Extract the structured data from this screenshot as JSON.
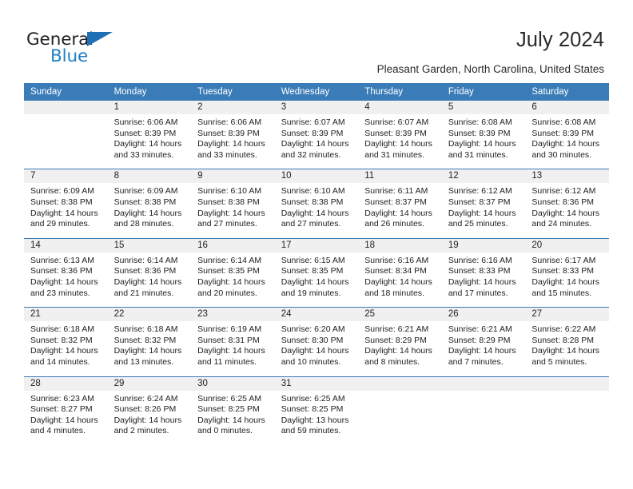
{
  "brand": {
    "name_part1": "General",
    "name_part2": "Blue",
    "logo_icon": "blue-triangle-icon",
    "color_primary": "#1f7fc4",
    "color_text": "#231f20"
  },
  "header": {
    "title": "July 2024",
    "subtitle": "Pleasant Garden, North Carolina, United States"
  },
  "calendar": {
    "header_bg": "#3a7cb8",
    "daynum_bg": "#f0f0f0",
    "columns": [
      "Sunday",
      "Monday",
      "Tuesday",
      "Wednesday",
      "Thursday",
      "Friday",
      "Saturday"
    ],
    "weeks": [
      [
        {
          "day": "",
          "lines": []
        },
        {
          "day": "1",
          "lines": [
            "Sunrise: 6:06 AM",
            "Sunset: 8:39 PM",
            "Daylight: 14 hours",
            "and 33 minutes."
          ]
        },
        {
          "day": "2",
          "lines": [
            "Sunrise: 6:06 AM",
            "Sunset: 8:39 PM",
            "Daylight: 14 hours",
            "and 33 minutes."
          ]
        },
        {
          "day": "3",
          "lines": [
            "Sunrise: 6:07 AM",
            "Sunset: 8:39 PM",
            "Daylight: 14 hours",
            "and 32 minutes."
          ]
        },
        {
          "day": "4",
          "lines": [
            "Sunrise: 6:07 AM",
            "Sunset: 8:39 PM",
            "Daylight: 14 hours",
            "and 31 minutes."
          ]
        },
        {
          "day": "5",
          "lines": [
            "Sunrise: 6:08 AM",
            "Sunset: 8:39 PM",
            "Daylight: 14 hours",
            "and 31 minutes."
          ]
        },
        {
          "day": "6",
          "lines": [
            "Sunrise: 6:08 AM",
            "Sunset: 8:39 PM",
            "Daylight: 14 hours",
            "and 30 minutes."
          ]
        }
      ],
      [
        {
          "day": "7",
          "lines": [
            "Sunrise: 6:09 AM",
            "Sunset: 8:38 PM",
            "Daylight: 14 hours",
            "and 29 minutes."
          ]
        },
        {
          "day": "8",
          "lines": [
            "Sunrise: 6:09 AM",
            "Sunset: 8:38 PM",
            "Daylight: 14 hours",
            "and 28 minutes."
          ]
        },
        {
          "day": "9",
          "lines": [
            "Sunrise: 6:10 AM",
            "Sunset: 8:38 PM",
            "Daylight: 14 hours",
            "and 27 minutes."
          ]
        },
        {
          "day": "10",
          "lines": [
            "Sunrise: 6:10 AM",
            "Sunset: 8:38 PM",
            "Daylight: 14 hours",
            "and 27 minutes."
          ]
        },
        {
          "day": "11",
          "lines": [
            "Sunrise: 6:11 AM",
            "Sunset: 8:37 PM",
            "Daylight: 14 hours",
            "and 26 minutes."
          ]
        },
        {
          "day": "12",
          "lines": [
            "Sunrise: 6:12 AM",
            "Sunset: 8:37 PM",
            "Daylight: 14 hours",
            "and 25 minutes."
          ]
        },
        {
          "day": "13",
          "lines": [
            "Sunrise: 6:12 AM",
            "Sunset: 8:36 PM",
            "Daylight: 14 hours",
            "and 24 minutes."
          ]
        }
      ],
      [
        {
          "day": "14",
          "lines": [
            "Sunrise: 6:13 AM",
            "Sunset: 8:36 PM",
            "Daylight: 14 hours",
            "and 23 minutes."
          ]
        },
        {
          "day": "15",
          "lines": [
            "Sunrise: 6:14 AM",
            "Sunset: 8:36 PM",
            "Daylight: 14 hours",
            "and 21 minutes."
          ]
        },
        {
          "day": "16",
          "lines": [
            "Sunrise: 6:14 AM",
            "Sunset: 8:35 PM",
            "Daylight: 14 hours",
            "and 20 minutes."
          ]
        },
        {
          "day": "17",
          "lines": [
            "Sunrise: 6:15 AM",
            "Sunset: 8:35 PM",
            "Daylight: 14 hours",
            "and 19 minutes."
          ]
        },
        {
          "day": "18",
          "lines": [
            "Sunrise: 6:16 AM",
            "Sunset: 8:34 PM",
            "Daylight: 14 hours",
            "and 18 minutes."
          ]
        },
        {
          "day": "19",
          "lines": [
            "Sunrise: 6:16 AM",
            "Sunset: 8:33 PM",
            "Daylight: 14 hours",
            "and 17 minutes."
          ]
        },
        {
          "day": "20",
          "lines": [
            "Sunrise: 6:17 AM",
            "Sunset: 8:33 PM",
            "Daylight: 14 hours",
            "and 15 minutes."
          ]
        }
      ],
      [
        {
          "day": "21",
          "lines": [
            "Sunrise: 6:18 AM",
            "Sunset: 8:32 PM",
            "Daylight: 14 hours",
            "and 14 minutes."
          ]
        },
        {
          "day": "22",
          "lines": [
            "Sunrise: 6:18 AM",
            "Sunset: 8:32 PM",
            "Daylight: 14 hours",
            "and 13 minutes."
          ]
        },
        {
          "day": "23",
          "lines": [
            "Sunrise: 6:19 AM",
            "Sunset: 8:31 PM",
            "Daylight: 14 hours",
            "and 11 minutes."
          ]
        },
        {
          "day": "24",
          "lines": [
            "Sunrise: 6:20 AM",
            "Sunset: 8:30 PM",
            "Daylight: 14 hours",
            "and 10 minutes."
          ]
        },
        {
          "day": "25",
          "lines": [
            "Sunrise: 6:21 AM",
            "Sunset: 8:29 PM",
            "Daylight: 14 hours",
            "and 8 minutes."
          ]
        },
        {
          "day": "26",
          "lines": [
            "Sunrise: 6:21 AM",
            "Sunset: 8:29 PM",
            "Daylight: 14 hours",
            "and 7 minutes."
          ]
        },
        {
          "day": "27",
          "lines": [
            "Sunrise: 6:22 AM",
            "Sunset: 8:28 PM",
            "Daylight: 14 hours",
            "and 5 minutes."
          ]
        }
      ],
      [
        {
          "day": "28",
          "lines": [
            "Sunrise: 6:23 AM",
            "Sunset: 8:27 PM",
            "Daylight: 14 hours",
            "and 4 minutes."
          ]
        },
        {
          "day": "29",
          "lines": [
            "Sunrise: 6:24 AM",
            "Sunset: 8:26 PM",
            "Daylight: 14 hours",
            "and 2 minutes."
          ]
        },
        {
          "day": "30",
          "lines": [
            "Sunrise: 6:25 AM",
            "Sunset: 8:25 PM",
            "Daylight: 14 hours",
            "and 0 minutes."
          ]
        },
        {
          "day": "31",
          "lines": [
            "Sunrise: 6:25 AM",
            "Sunset: 8:25 PM",
            "Daylight: 13 hours",
            "and 59 minutes."
          ]
        },
        {
          "day": "",
          "lines": []
        },
        {
          "day": "",
          "lines": []
        },
        {
          "day": "",
          "lines": []
        }
      ]
    ]
  }
}
